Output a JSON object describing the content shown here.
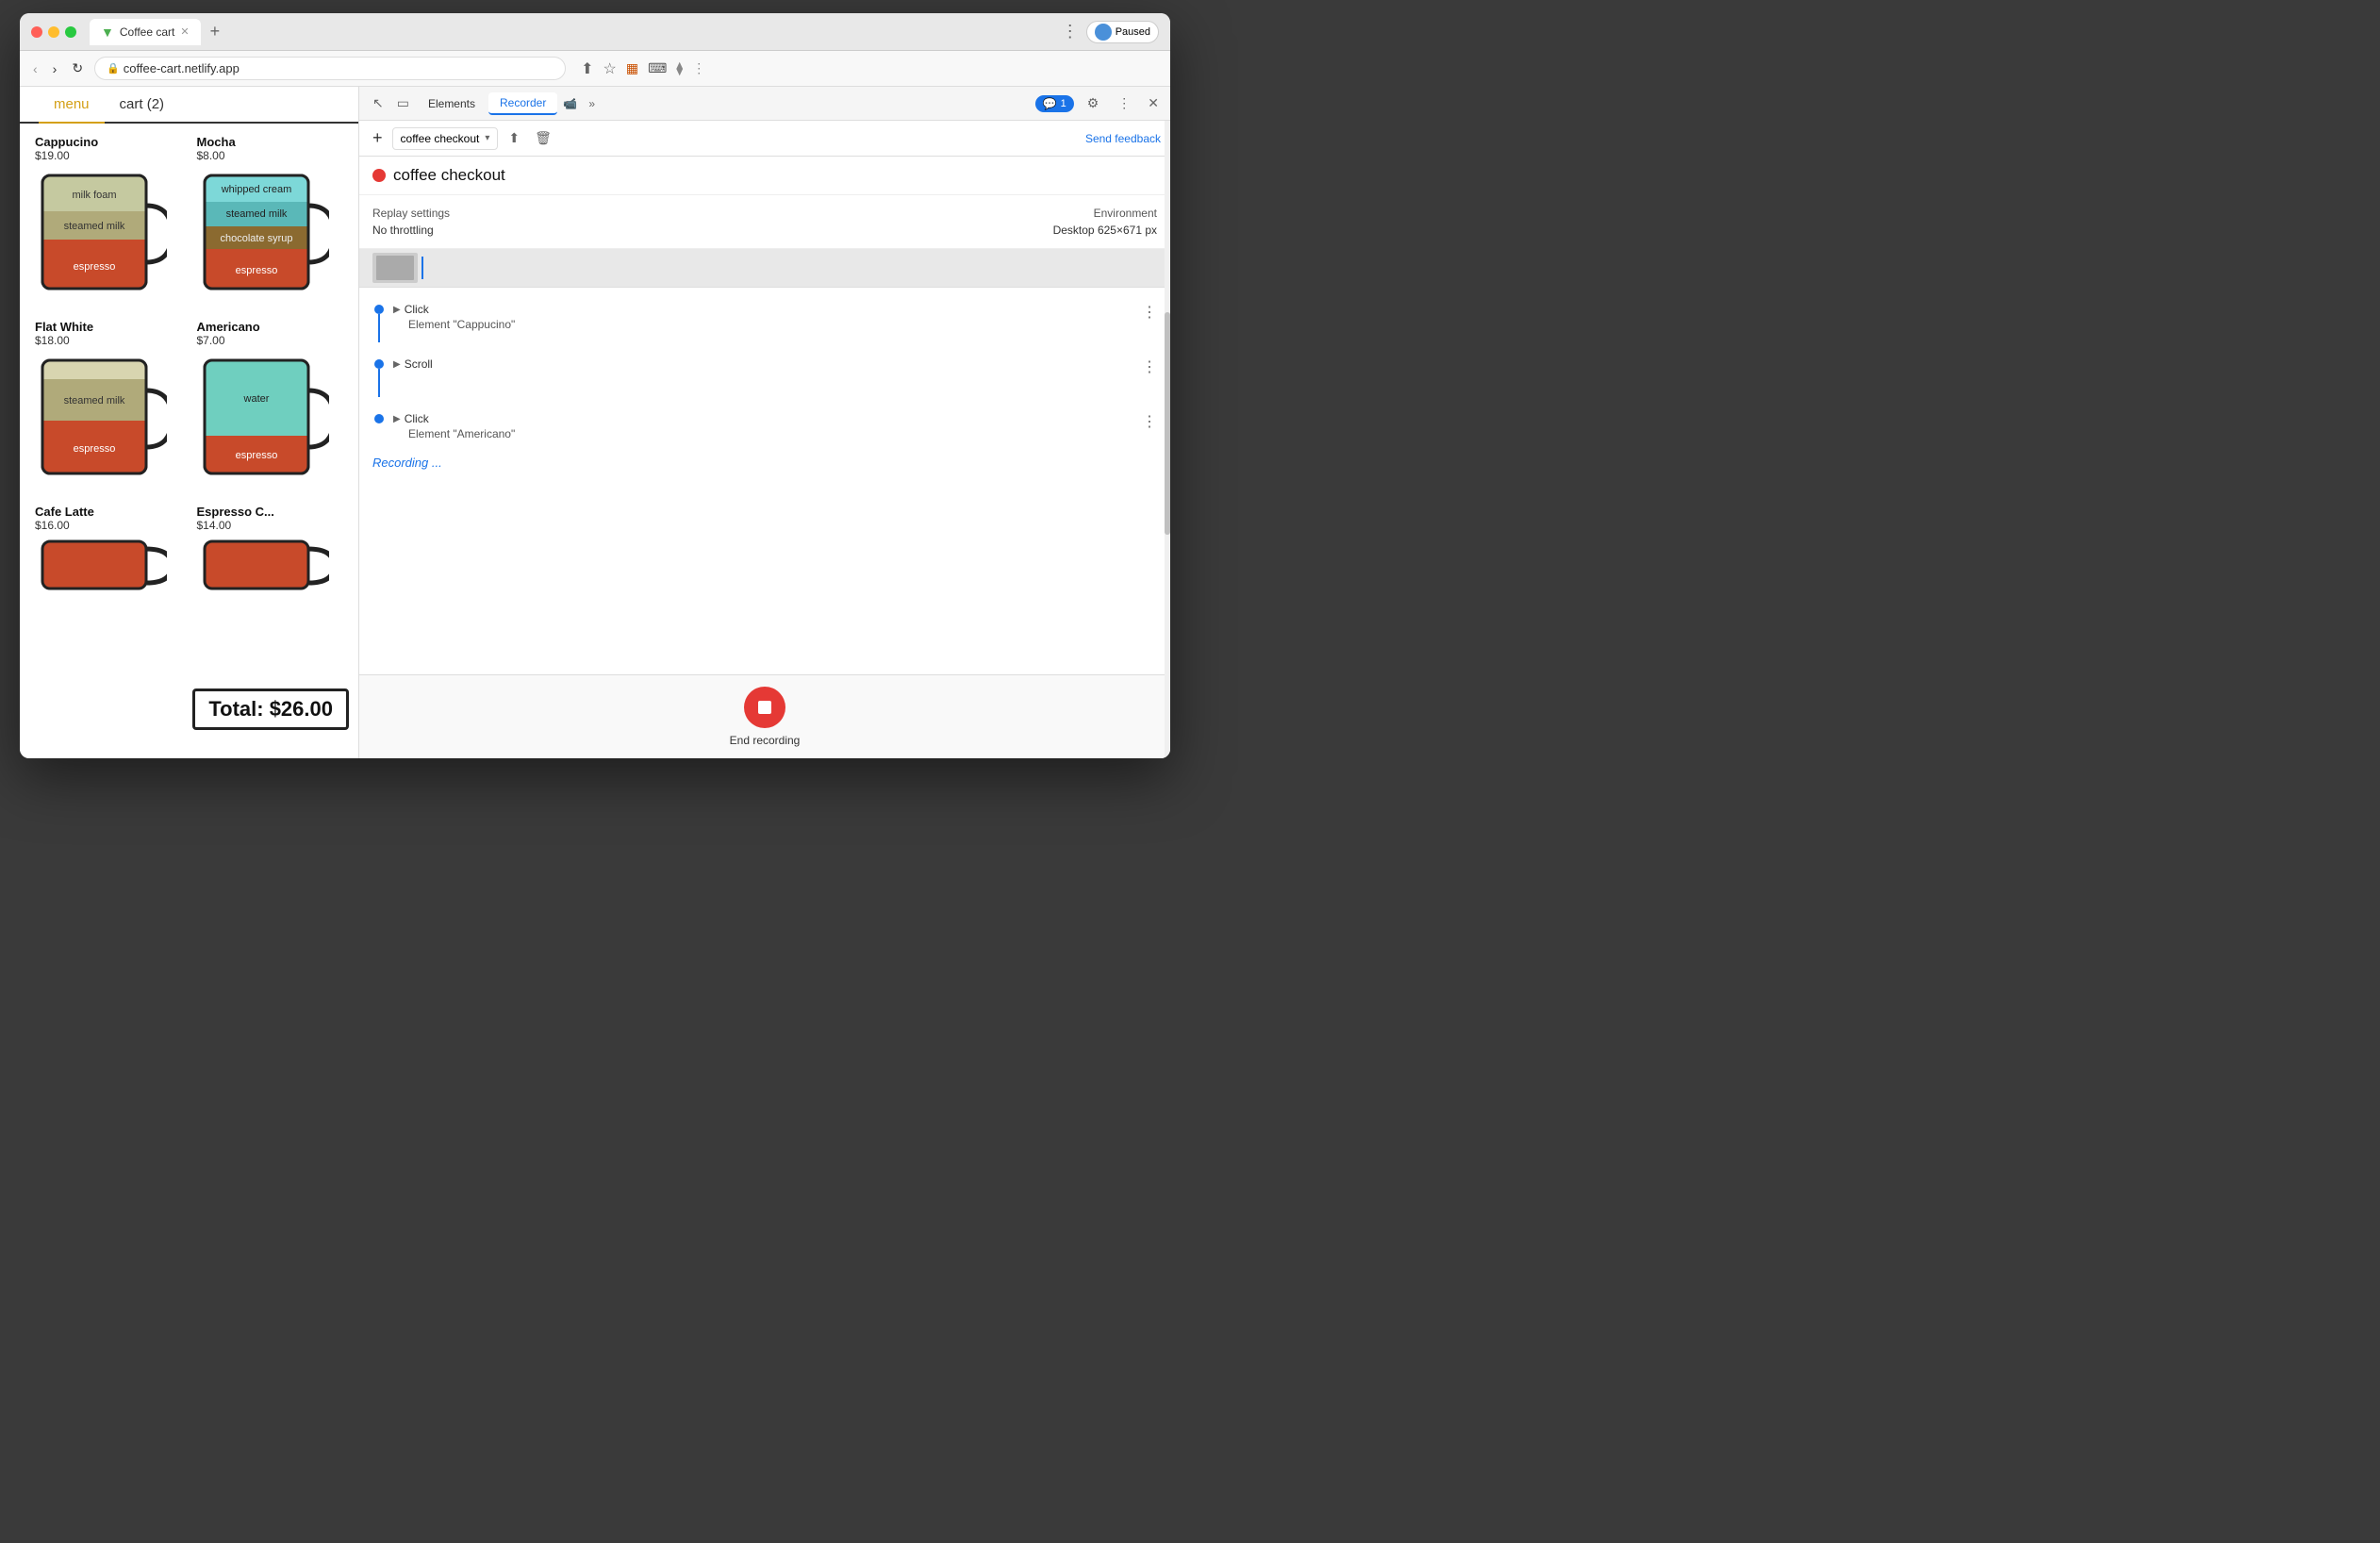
{
  "browser": {
    "tab_title": "Coffee cart",
    "tab_favicon": "▼",
    "new_tab": "+",
    "address": "coffee-cart.netlify.app",
    "paused_label": "Paused"
  },
  "coffee_app": {
    "nav": {
      "menu_label": "menu",
      "cart_label": "cart (2)"
    },
    "items": [
      {
        "name": "Cappucino",
        "price": "$19.00",
        "layers": [
          {
            "label": "milk foam",
            "color": "#c5c9a0",
            "height": 38
          },
          {
            "label": "steamed milk",
            "color": "#b0aa7a",
            "height": 30
          },
          {
            "label": "espresso",
            "color": "#c84a2a",
            "height": 36
          }
        ]
      },
      {
        "name": "Mocha",
        "price": "$8.00",
        "layers": [
          {
            "label": "whipped cream",
            "color": "#6fcfcf",
            "height": 30
          },
          {
            "label": "steamed milk",
            "color": "#5ab8b8",
            "height": 28
          },
          {
            "label": "chocolate syrup",
            "color": "#8b6a30",
            "height": 26
          },
          {
            "label": "espresso",
            "color": "#c84a2a",
            "height": 36
          }
        ]
      },
      {
        "name": "Flat White",
        "price": "$18.00",
        "layers": [
          {
            "label": "",
            "color": "#d8d5b0",
            "height": 20
          },
          {
            "label": "steamed milk",
            "color": "#b0aa7a",
            "height": 44
          },
          {
            "label": "espresso",
            "color": "#c84a2a",
            "height": 36
          }
        ]
      },
      {
        "name": "Americano",
        "price": "$7.00",
        "layers": [
          {
            "label": "water",
            "color": "#6fcfbf",
            "height": 80
          },
          {
            "label": "espresso",
            "color": "#c84a2a",
            "height": 36
          }
        ]
      },
      {
        "name": "Cafe Latte",
        "price": "$16.00",
        "layers": []
      },
      {
        "name": "Espresso C...",
        "price": "$14.00",
        "layers": []
      }
    ],
    "total": "Total: $26.00"
  },
  "devtools": {
    "tabs": [
      "Elements",
      "Recorder",
      ""
    ],
    "active_tab": "Recorder",
    "chat_count": "1",
    "recording": {
      "name": "coffee checkout",
      "dropdown_label": "coffee checkout",
      "dot_color": "#e53935"
    },
    "send_feedback": "Send feedback",
    "replay": {
      "settings_label": "Replay settings",
      "throttle_label": "No throttling",
      "env_label": "Environment",
      "env_value": "Desktop",
      "resolution": "625×671 px"
    },
    "steps": [
      {
        "type": "Click",
        "element": "Element \"Cappucino\"",
        "has_thumbnail": true
      },
      {
        "type": "Scroll",
        "element": "",
        "has_thumbnail": false
      },
      {
        "type": "Click",
        "element": "Element \"Americano\"",
        "has_thumbnail": false
      }
    ],
    "recording_status": "Recording ...",
    "end_recording_label": "End recording"
  }
}
